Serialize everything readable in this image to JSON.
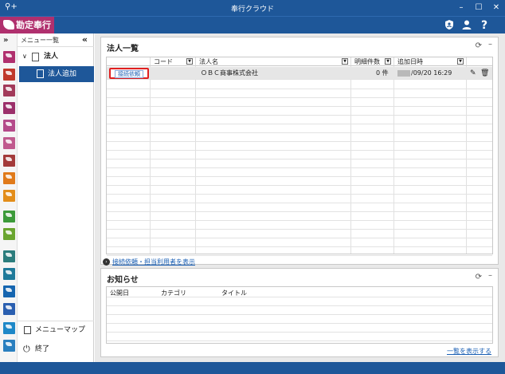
{
  "window": {
    "title": "奉行クラウド",
    "buttons": [
      "–",
      "☐",
      "✕"
    ]
  },
  "appbar": {
    "brand": "勘定奉行",
    "icons": [
      "shield-user-icon",
      "user-icon",
      "help-icon"
    ]
  },
  "colors": {
    "primary": "#1e5799",
    "brand": "#b0306e",
    "link": "#1a5fb4",
    "highlight_border": "#e02020"
  },
  "iconstrip": {
    "toggle": "»",
    "app_colors": [
      "#b0306e",
      "#c0392b",
      "#a23a5a",
      "#9b2f6a",
      "#b44a8a",
      "#c05a8e",
      "#a33a3a",
      "#e07a1a",
      "#e38d1a",
      "#3c9a3a",
      "#6aa52f",
      "#2c7d7d",
      "#1f7a9a",
      "#1565b0",
      "#2a5fb0",
      "#1e88c8",
      "#2a7fbf"
    ]
  },
  "menu": {
    "header": "メニュー一覧",
    "collapse": "«",
    "group_label": "法人",
    "active_item": "法人追加",
    "menu_map": "メニューマップ",
    "exit": "終了"
  },
  "corp_list": {
    "title": "法人一覧",
    "columns": [
      "コード",
      "法人名",
      "明細件数",
      "追加日時"
    ],
    "rows": [
      {
        "action": "接続依頼",
        "code": "",
        "name": "ＯＢＣ商事株式会社",
        "count": "0 件",
        "date": "/09/20 16:29"
      }
    ],
    "footer_link": "接続依頼・担当利用者を表示"
  },
  "notices": {
    "title": "お知らせ",
    "columns": [
      "公開日",
      "カテゴリ",
      "タイトル"
    ],
    "view_all": "一覧を表示する"
  }
}
